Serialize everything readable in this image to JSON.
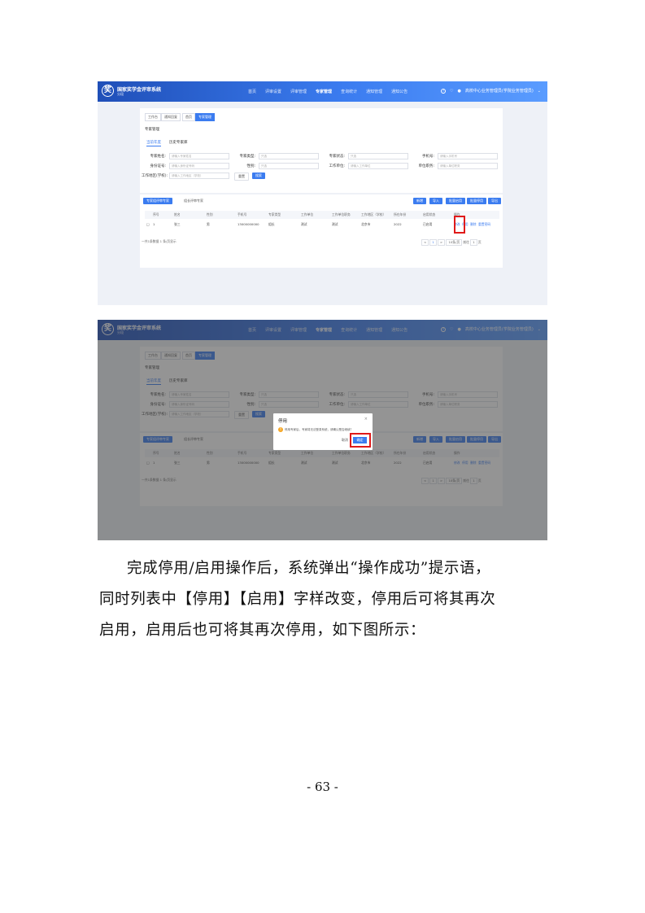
{
  "app": {
    "title": "国家奖学金评审系统",
    "subtitle": "分段",
    "nav": [
      "首页",
      "评审设置",
      "评审管理",
      "专家管理",
      "查询统计",
      "通知管理",
      "通知公告"
    ],
    "active_nav_index": 3,
    "user": "高校中心业务管理员(学院业务管理员)",
    "accent_color": "#3b7cf0"
  },
  "breadcrumbs": [
    "工作台",
    "通知回复",
    "首页",
    "专家管理"
  ],
  "page_title": "专家管理",
  "subtabs": [
    "当前年度",
    "历史专家库"
  ],
  "form": {
    "rows": [
      [
        {
          "label": "专家姓名:",
          "placeholder": "请输入专家姓名"
        },
        {
          "label": "专家类型:",
          "placeholder": "只选"
        },
        {
          "label": "专家状态:",
          "placeholder": "只选"
        },
        {
          "label": "手机号:",
          "placeholder": "请输入手机号"
        }
      ],
      [
        {
          "label": "身份证号:",
          "placeholder": "请输入身份证号码"
        },
        {
          "label": "性别:",
          "placeholder": "只选"
        },
        {
          "label": "工作单位:",
          "placeholder": "请输入工作单位"
        },
        {
          "label": "单位职务:",
          "placeholder": "请输入单位职务"
        }
      ],
      [
        {
          "label": "工作地区(学校):",
          "placeholder": "请输入工作地区（学校）"
        }
      ]
    ],
    "reset_label": "重置",
    "search_label": "搜索"
  },
  "table_tabs": [
    "专家组评审专家",
    "组长评审专家"
  ],
  "actions": [
    "新增",
    "导入",
    "批量启用",
    "批量停用",
    "导出"
  ],
  "table": {
    "headers": [
      "",
      "序号",
      "姓名",
      "性别",
      "手机号",
      "专家类型",
      "工作单位",
      "工作单位职务",
      "工作地区（学校）",
      "所在年份",
      "启用状态",
      "操作"
    ],
    "rows": [
      {
        "cells": [
          "",
          "1",
          "张三",
          "男",
          "13000000000",
          "组长",
          "测试",
          "测试",
          "北京市",
          "2022",
          "已启用"
        ],
        "ops": [
          "修改",
          "停用",
          "删除",
          "重置密码"
        ]
      }
    ]
  },
  "pagination": {
    "summary": "一共1条数据 1 条/页显示",
    "prev": "<",
    "page": "1",
    "next": ">",
    "page_size": "10条/页",
    "goto_label": "前往",
    "goto_page": "1",
    "goto_unit": "页"
  },
  "dialog": {
    "title": "停用",
    "close": "×",
    "warn_icon": "!",
    "message": "停用专家后，专家将无法登录系统，请确认是否继续？",
    "cancel": "取消",
    "confirm": "确定"
  },
  "paragraph": {
    "line1": "完成停用/启用操作后，系统弹出“操作成功”提示语，",
    "line2": "同时列表中【停用】【启用】字样改变，停用后可将其再次",
    "line3": "启用，启用后也可将其再次停用，如下图所示："
  },
  "page_number": "- 63 -"
}
